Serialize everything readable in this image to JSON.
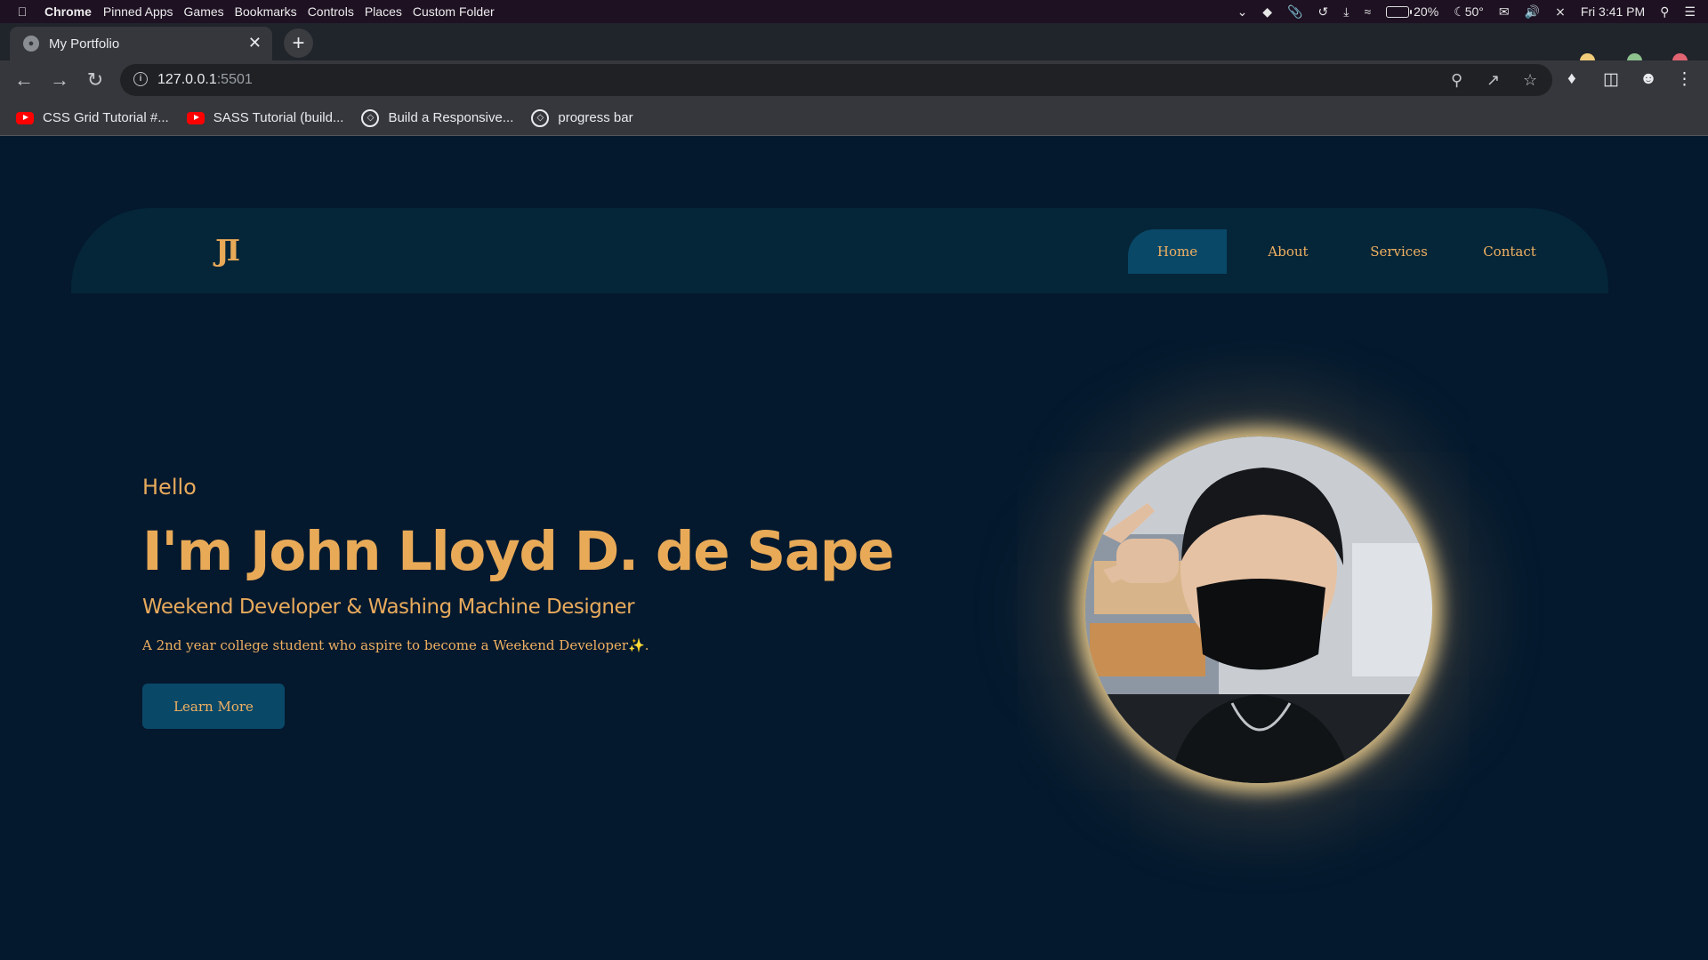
{
  "menubar": {
    "app": "Chrome",
    "items": [
      "Pinned Apps",
      "Games",
      "Bookmarks",
      "Controls",
      "Places",
      "Custom Folder"
    ],
    "battery": "20%",
    "weather": "50°",
    "clock": "Fri 3:41 PM"
  },
  "browser": {
    "tab_title": "My Portfolio",
    "url_host": "127.0.0.1",
    "url_port": ":5501",
    "bookmarks": [
      {
        "label": "CSS Grid Tutorial #...",
        "icon": "youtube-icon"
      },
      {
        "label": "SASS Tutorial (build...",
        "icon": "youtube-icon"
      },
      {
        "label": "Build a Responsive...",
        "icon": "codepen-icon"
      },
      {
        "label": "progress bar",
        "icon": "codepen-icon"
      }
    ]
  },
  "site": {
    "logo": "JI",
    "nav": [
      "Home",
      "About",
      "Services",
      "Contact"
    ],
    "active_nav": "Home",
    "hello": "Hello",
    "name": "I'm John Lloyd D. de Sape",
    "role": "Weekend Developer & Washing Machine Designer",
    "description": "A 2nd year college student who aspire to become a Weekend Developer✨.",
    "cta": "Learn More"
  },
  "colors": {
    "accent": "#e9aa58",
    "page_bg": "#04192e",
    "header_bg": "#052638",
    "button_bg": "#0a4868"
  }
}
